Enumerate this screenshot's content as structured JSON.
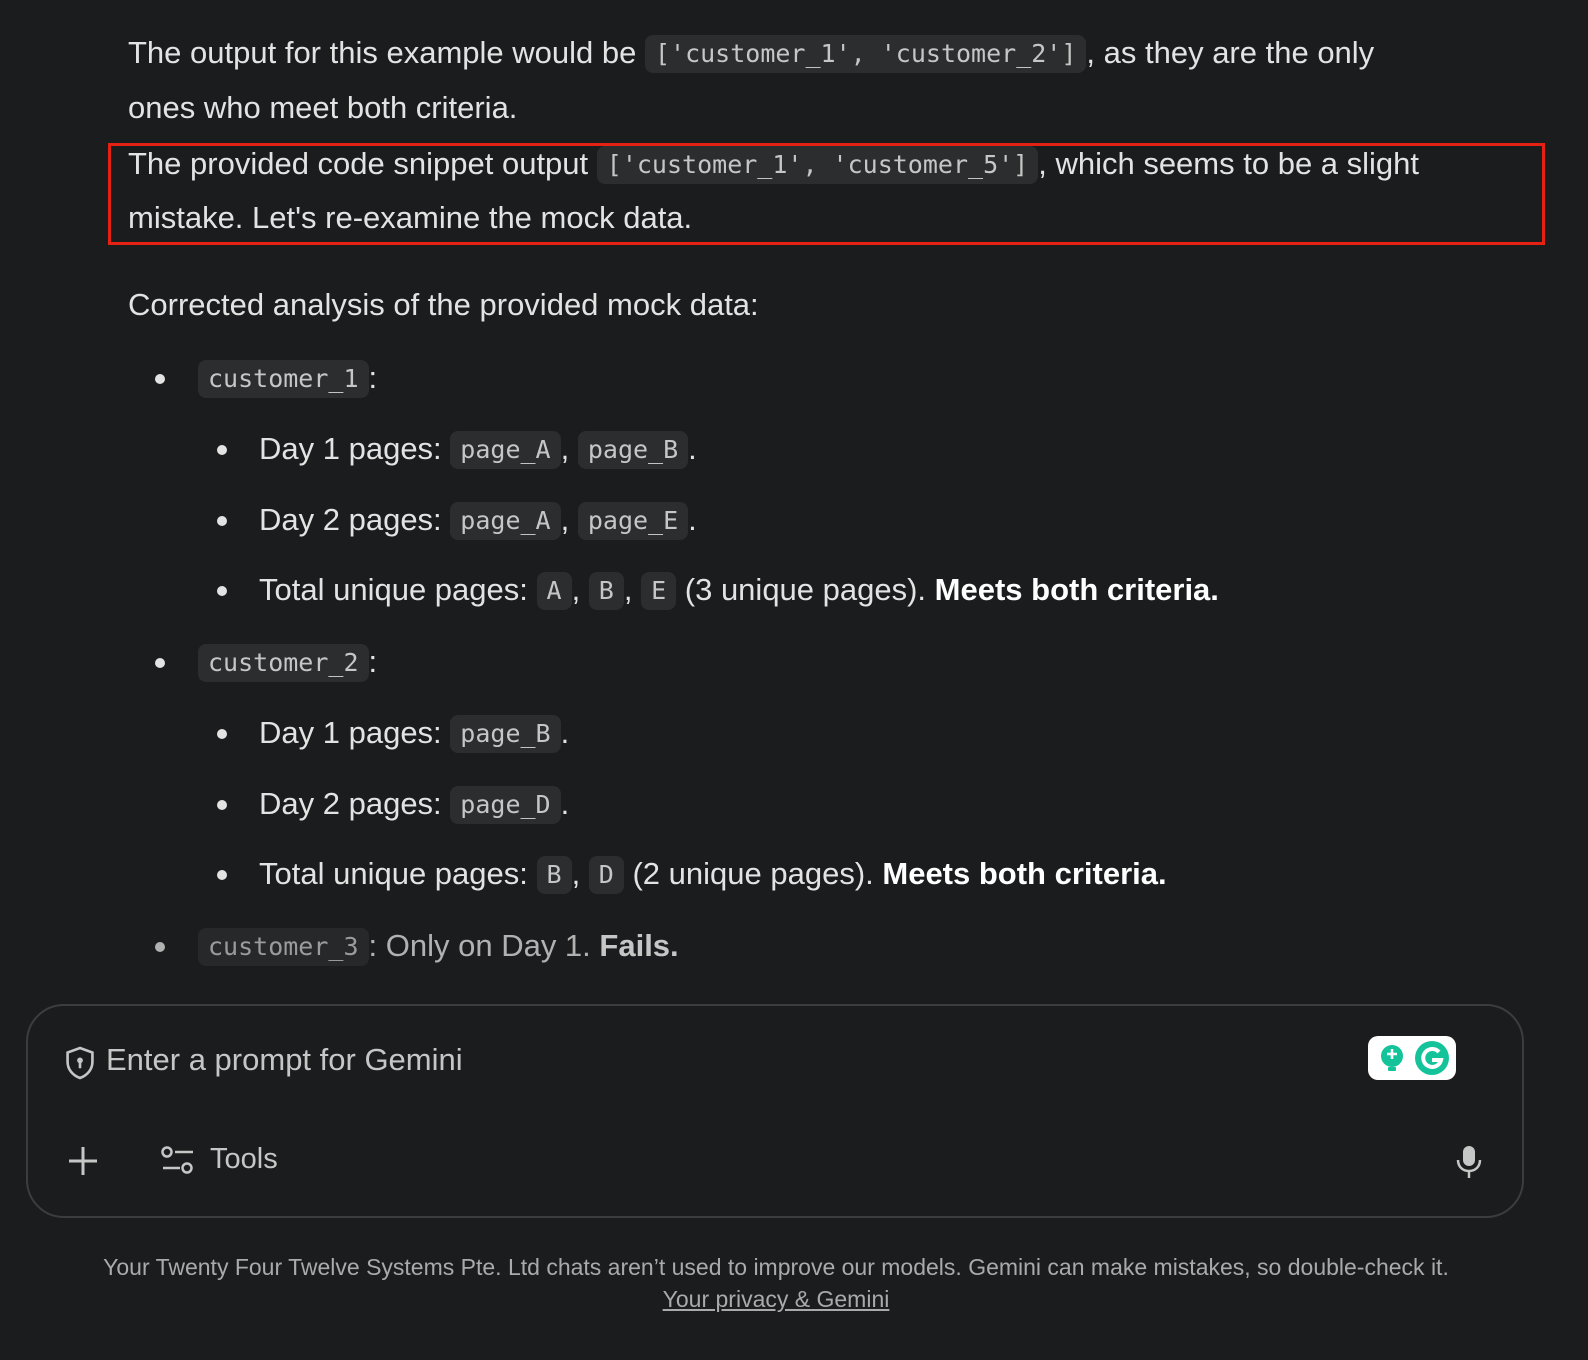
{
  "conversation": {
    "para1": {
      "before": "The output for this example would be ",
      "code": "['customer_1', 'customer_2']",
      "after": ", as they are the only",
      "line2": "ones who meet both criteria."
    },
    "para2": {
      "before": "The provided code snippet output ",
      "code": "['customer_1', 'customer_5']",
      "after": ", which seems to be a slight",
      "line2": "mistake. Let's re-examine the mock data."
    },
    "para3": "Corrected analysis of the provided mock data:",
    "customers": [
      {
        "id": "customer_1",
        "day1_label": "Day 1 pages: ",
        "day1_pages": [
          "page_A",
          "page_B"
        ],
        "day2_label": "Day 2 pages: ",
        "day2_pages": [
          "page_A",
          "page_E"
        ],
        "total_label": "Total unique pages: ",
        "total_pages": [
          "A",
          "B",
          "E"
        ],
        "total_note": " (3 unique pages). ",
        "verdict": "Meets both criteria."
      },
      {
        "id": "customer_2",
        "day1_label": "Day 1 pages: ",
        "day1_pages": [
          "page_B"
        ],
        "day2_label": "Day 2 pages: ",
        "day2_pages": [
          "page_D"
        ],
        "total_label": "Total unique pages: ",
        "total_pages": [
          "B",
          "D"
        ],
        "total_note": " (2 unique pages). ",
        "verdict": "Meets both criteria."
      },
      {
        "id": "customer_3",
        "note": ": Only on Day 1. ",
        "verdict": "Fails."
      }
    ]
  },
  "prompt": {
    "placeholder": "Enter a prompt for Gemini",
    "tools_label": "Tools"
  },
  "footer": {
    "notice": "Your Twenty Four Twelve Systems Pte. Ltd chats aren’t used to improve our models. Gemini can make mistakes, so double-check it.",
    "privacy_link": "Your privacy & Gemini"
  },
  "colors": {
    "background": "#1b1c1d",
    "highlight_border": "#e52113",
    "code_background": "#2c2d2f"
  }
}
